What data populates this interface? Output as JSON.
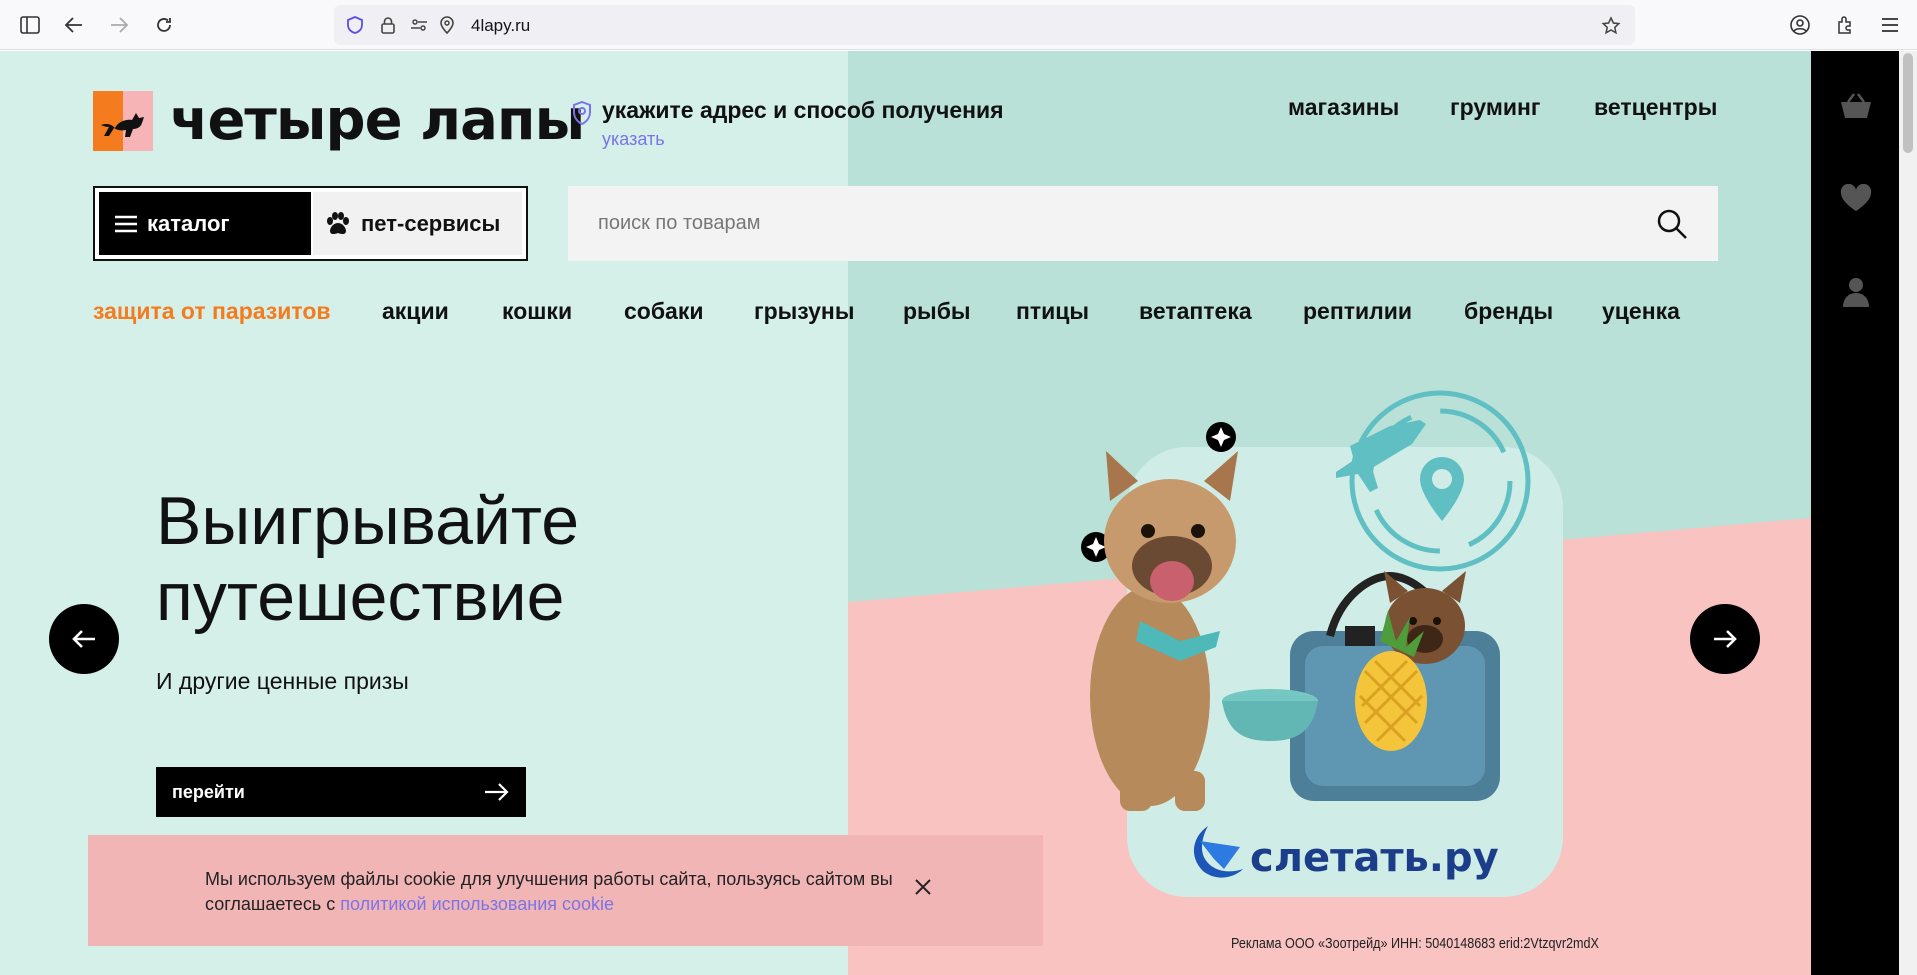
{
  "browser": {
    "url": "4lapy.ru",
    "icons": [
      "sidebar-icon",
      "back-icon",
      "forward-icon",
      "reload-icon",
      "shield-icon",
      "lock-icon",
      "permissions-icon",
      "location-icon",
      "bookmark-star-icon",
      "account-icon",
      "extensions-icon",
      "menu-icon"
    ]
  },
  "header": {
    "logo_text": "четыре лапы",
    "address_title": "укажите адрес и способ получения",
    "address_link": "указать",
    "top_nav": [
      "магазины",
      "груминг",
      "ветцентры"
    ],
    "catalog_label": "каталог",
    "pet_services_label": "пет-сервисы",
    "search_placeholder": "поиск по товарам"
  },
  "category_nav": [
    "защита от паразитов",
    "акции",
    "кошки",
    "собаки",
    "грызуны",
    "рыбы",
    "птицы",
    "ветаптека",
    "рептилии",
    "бренды",
    "уценка"
  ],
  "hero": {
    "title_line1": "Выигрывайте",
    "title_line2": "путешествие",
    "subtitle": "И другие ценные призы",
    "button_label": "перейти",
    "promo_brand": "слетать.ру",
    "ad_disclaimer": "Реклама ООО «Зоотрейд» ИНН: 5040148683 erid:2Vtzqvr2mdX"
  },
  "cookie": {
    "text": "Мы используем файлы cookie для улучшения работы сайта, пользуясь сайтом вы соглашаетесь с ",
    "link": "политикой использования cookie"
  },
  "right_rail": [
    "basket-icon",
    "heart-icon",
    "user-icon"
  ],
  "colors": {
    "accent_orange": "#f57b1f",
    "link_purple": "#7b74e8",
    "bg_mint": "#d5efe9",
    "bg_pink": "#f8c3c1",
    "cookie_bg": "#f2b5b6"
  }
}
